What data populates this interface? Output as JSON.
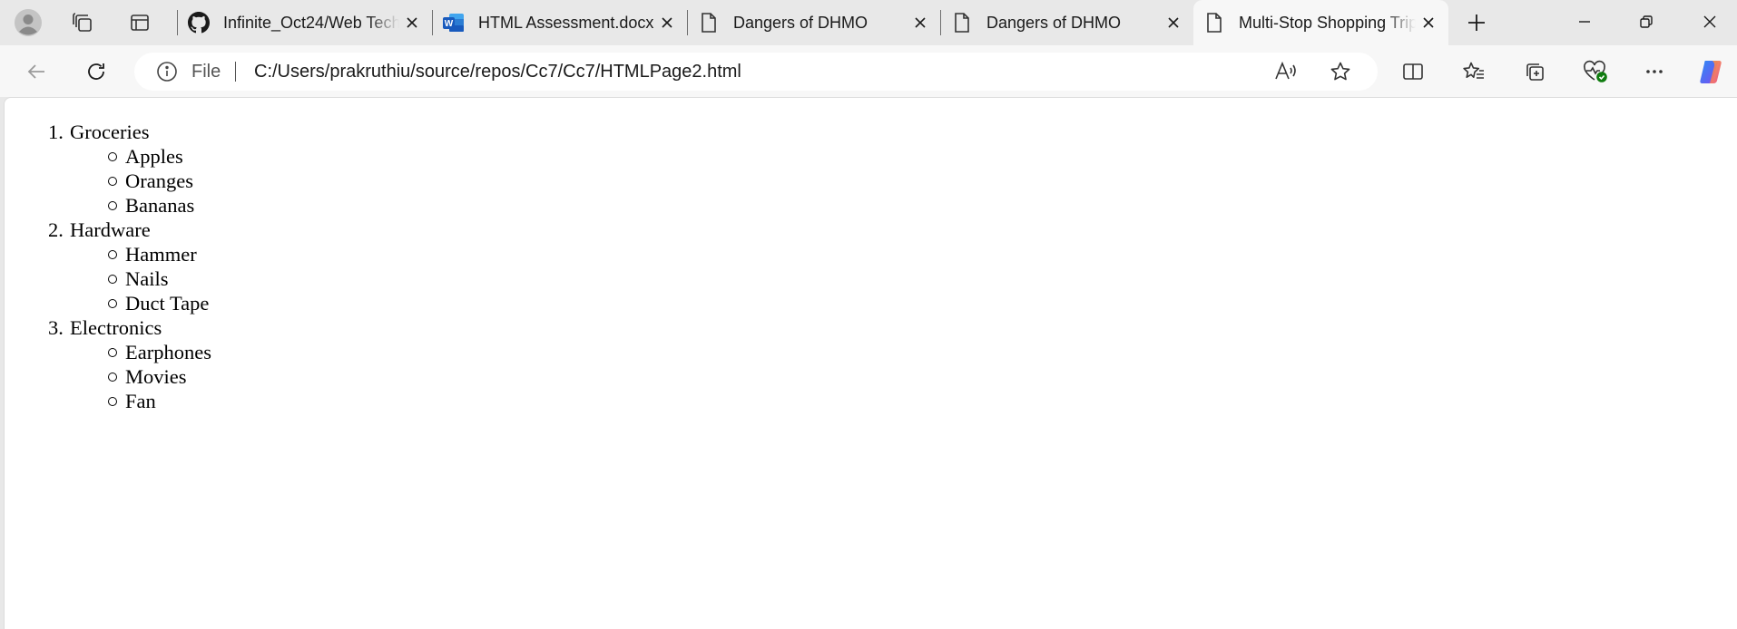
{
  "browser": {
    "tabs": [
      {
        "title": "Infinite_Oct24/Web Tech",
        "icon": "github-icon",
        "active": false
      },
      {
        "title": "HTML Assessment.docx",
        "icon": "word-icon",
        "active": false
      },
      {
        "title": "Dangers of DHMO",
        "icon": "page-icon",
        "active": false
      },
      {
        "title": "Dangers of DHMO",
        "icon": "page-icon",
        "active": false
      },
      {
        "title": "Multi-Stop Shopping Trip",
        "icon": "page-icon",
        "active": true
      }
    ],
    "address": {
      "protocol": "File",
      "url": "C:/Users/prakruthiu/source/repos/Cc7/Cc7/HTMLPage2.html"
    },
    "colors": {
      "accent": "#0078d4",
      "word_blue": "#185abd",
      "status_green": "#107c10"
    }
  },
  "page": {
    "categories": [
      {
        "number": "1.",
        "name": "Groceries",
        "items": [
          "Apples",
          "Oranges",
          "Bananas"
        ]
      },
      {
        "number": "2.",
        "name": "Hardware",
        "items": [
          "Hammer",
          "Nails",
          "Duct Tape"
        ]
      },
      {
        "number": "3.",
        "name": "Electronics",
        "items": [
          "Earphones",
          "Movies",
          "Fan"
        ]
      }
    ]
  }
}
